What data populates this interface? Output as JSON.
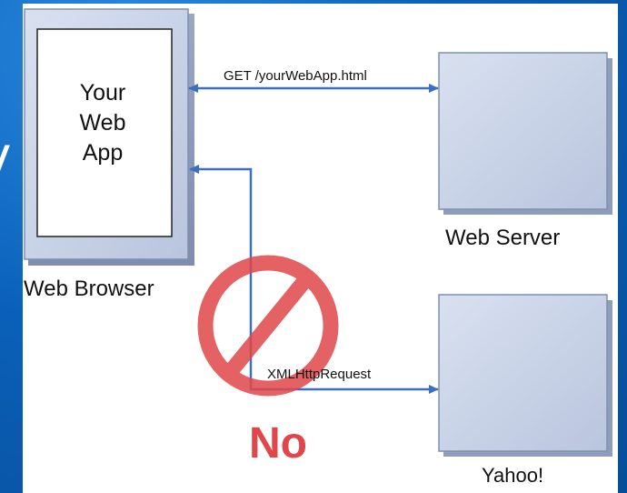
{
  "slide": {
    "edge_text": "/"
  },
  "diagram": {
    "browser": {
      "app_text": "Your\nWeb\nApp",
      "label": "Web Browser"
    },
    "web_server": {
      "label": "Web Server"
    },
    "yahoo": {
      "label": "Yahoo!"
    },
    "get_request": {
      "label": "GET /yourWebApp.html"
    },
    "xhr_request": {
      "label": "XMLHttpRequest"
    },
    "prohibition": {
      "label": "No",
      "color": "#e0464a"
    },
    "colors": {
      "arrow": "#3b6fc4",
      "box_fill": "#c9d3e8",
      "box_border": "#7f8fad"
    }
  }
}
